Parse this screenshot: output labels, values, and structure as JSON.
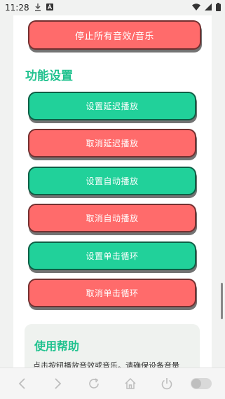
{
  "status_bar": {
    "time": "11:28",
    "icons": [
      "download-icon",
      "notification-a-icon",
      "wifi-icon",
      "signal-icon",
      "battery-icon"
    ]
  },
  "buttons": {
    "stop_all": "停止所有音效/音乐",
    "set_delay": "设置延迟播放",
    "cancel_delay": "取消延迟播放",
    "set_auto": "设置自动播放",
    "cancel_auto": "取消自动播放",
    "set_loop": "设置单击循环",
    "cancel_loop": "取消单击循环"
  },
  "section": {
    "title": "功能设置"
  },
  "help": {
    "title": "使用帮助",
    "text": "点击按钮播放音效或音乐。请确保设备音量"
  },
  "nav": {
    "icons": [
      "back-icon",
      "forward-icon",
      "refresh-icon",
      "home-icon",
      "power-icon",
      "toggle"
    ]
  },
  "colors": {
    "green": "#21d19a",
    "red": "#ff6b6b",
    "accent_text": "#21c28f"
  }
}
